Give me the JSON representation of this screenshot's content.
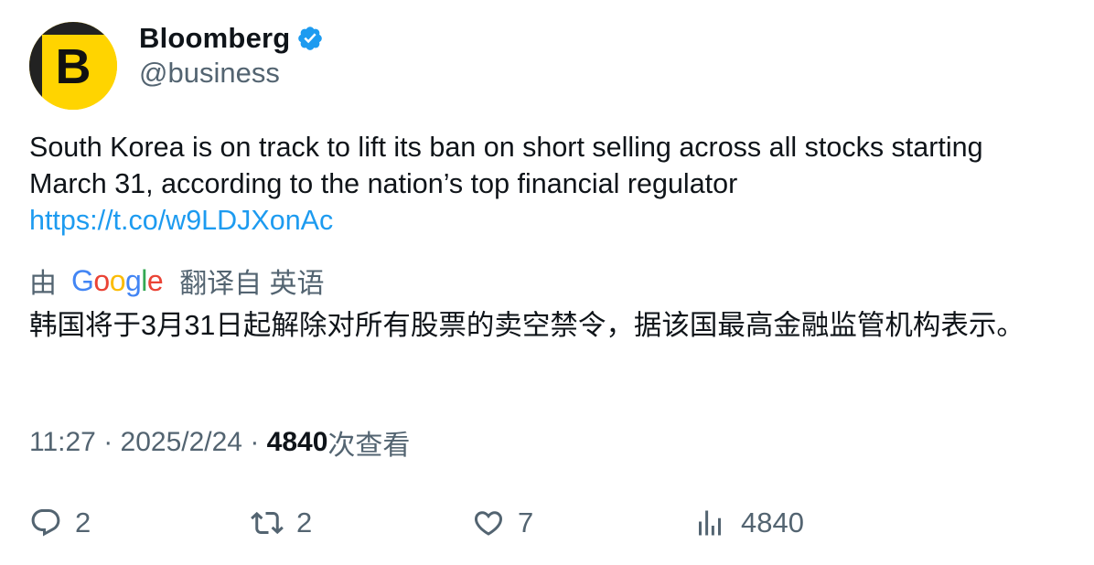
{
  "author": {
    "display_name": "Bloomberg",
    "handle": "@business",
    "avatar_letter": "B",
    "verified": true
  },
  "tweet": {
    "text": "South Korea is on track to lift its ban on short selling across all stocks starting March 31, according to the nation’s top financial regulator",
    "link": "https://t.co/w9LDJXonAc"
  },
  "translation": {
    "prefix": "由",
    "provider": "Google",
    "suffix": "翻译自 英语",
    "text": "韩国将于3月31日起解除对所有股票的卖空禁令，据该国最高金融监管机构表示。"
  },
  "meta": {
    "time": "11:27",
    "separator": " · ",
    "date": "2025/2/24",
    "views_count": "4840",
    "views_label": "次查看"
  },
  "actions": {
    "replies": "2",
    "retweets": "2",
    "likes": "7",
    "views": "4840"
  },
  "colors": {
    "text": "#0f1419",
    "secondary": "#536471",
    "link": "#1d9bf0",
    "verified": "#1d9bf0",
    "avatar_bg": "#ffd400"
  },
  "icons": {
    "reply": "reply-icon",
    "retweet": "retweet-icon",
    "like": "heart-icon",
    "views": "analytics-icon",
    "verified": "verified-badge-icon"
  }
}
